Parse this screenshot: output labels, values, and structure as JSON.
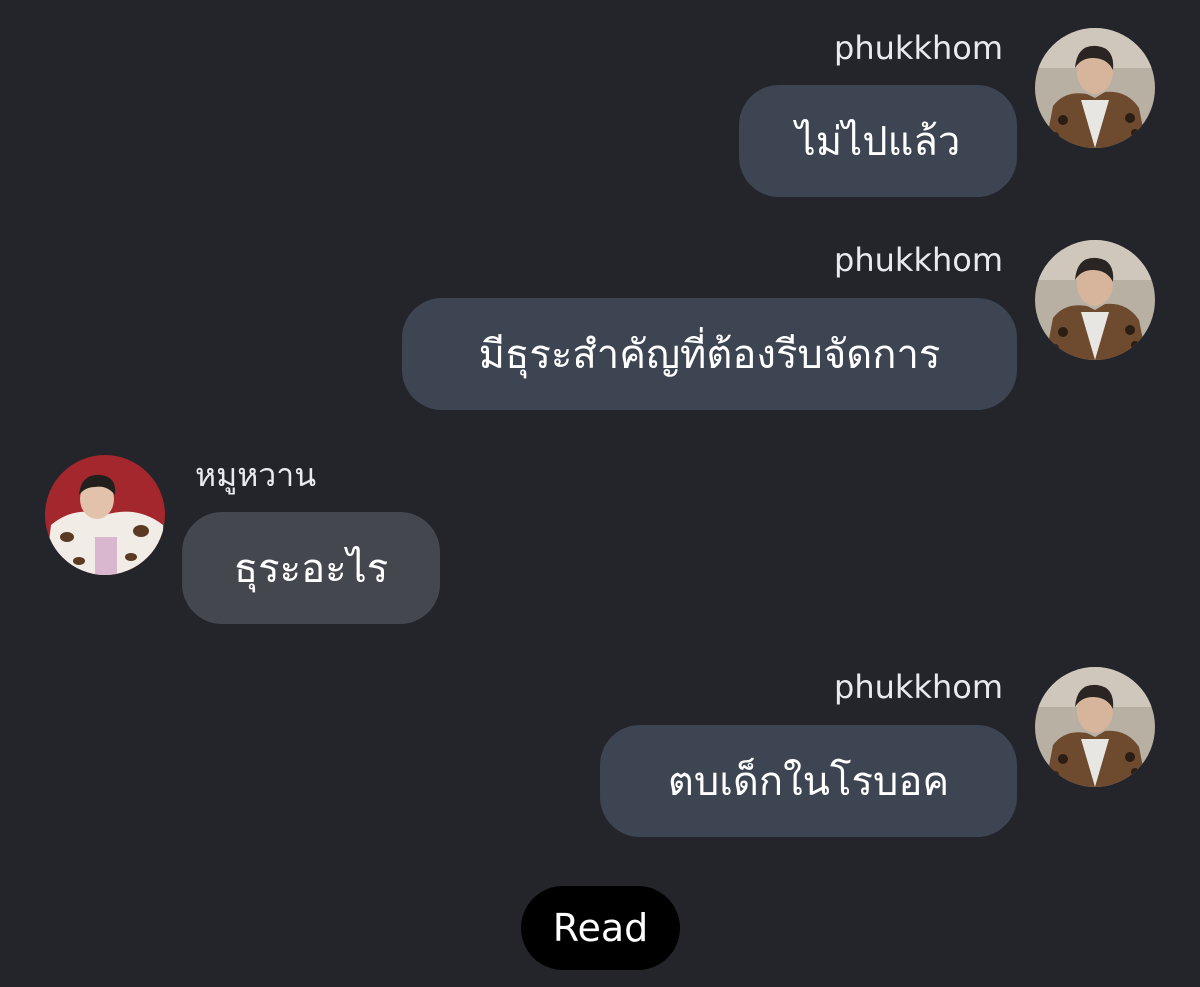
{
  "messages": [
    {
      "sender": "phukkhom",
      "text": "ไม่ไปแล้ว",
      "direction": "outgoing",
      "avatar_icon": "user-avatar-icon"
    },
    {
      "sender": "phukkhom",
      "text": "มีธุระสำคัญที่ต้องรีบจัดการ",
      "direction": "outgoing",
      "avatar_icon": "user-avatar-icon"
    },
    {
      "sender": "หมูหวาน",
      "text": "ธุระอะไร",
      "direction": "incoming",
      "avatar_icon": "user-avatar-icon"
    },
    {
      "sender": "phukkhom",
      "text": "ตบเด็กในโรบอค",
      "direction": "outgoing",
      "avatar_icon": "user-avatar-icon"
    }
  ],
  "status": {
    "read_label": "Read"
  },
  "colors": {
    "background": "#24252b",
    "outgoing_bubble": "#3d4452",
    "incoming_bubble": "#45474e",
    "read_pill": "#000000"
  }
}
